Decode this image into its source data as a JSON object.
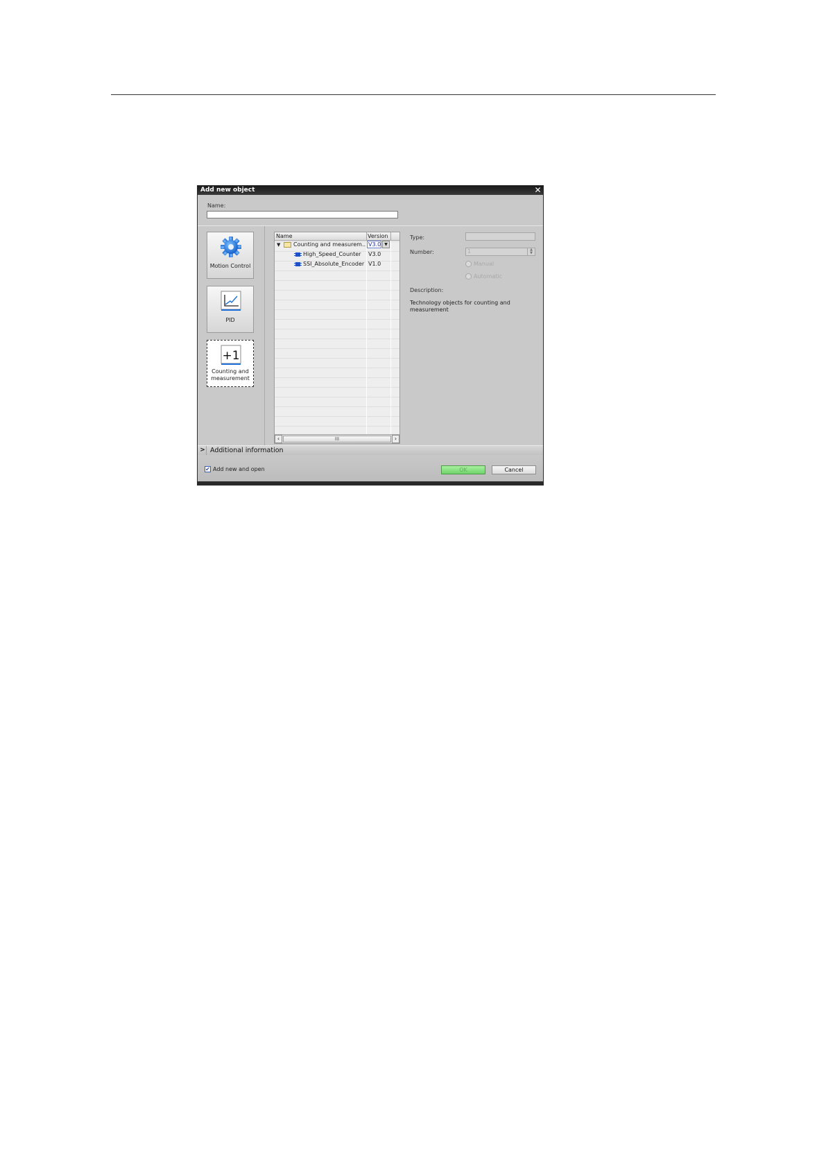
{
  "dialog": {
    "title": "Add new object",
    "name_label": "Name:",
    "name_value": ""
  },
  "categories": [
    {
      "label": "Motion Control",
      "icon": "gear-icon",
      "selected": false
    },
    {
      "label": "PID",
      "icon": "pid-chart-icon",
      "selected": false
    },
    {
      "label": "Counting and measurement",
      "label_line1": "Counting and",
      "label_line2": "measurement",
      "icon_text": "+1",
      "icon": "plus-one-icon",
      "selected": true
    }
  ],
  "tree": {
    "columns": {
      "name": "Name",
      "version": "Version"
    },
    "rows": [
      {
        "name": "Counting and measurem...",
        "version": "V3.0",
        "type": "folder",
        "expanded": true
      },
      {
        "name": "High_Speed_Counter",
        "version": "V3.0",
        "type": "object"
      },
      {
        "name": "SSI_Absolute_Encoder",
        "version": "V1.0",
        "type": "object"
      }
    ],
    "scroll_thumb": "III"
  },
  "properties": {
    "type_label": "Type:",
    "type_value": "",
    "number_label": "Number:",
    "number_value": "1",
    "radio_manual": "Manual",
    "radio_automatic": "Automatic",
    "description_label": "Description:",
    "description_text": "Technology objects for counting and measurement"
  },
  "additional_info": {
    "label": "Additional  information"
  },
  "footer": {
    "checkbox_label": "Add new and open",
    "checkbox_checked": true,
    "ok_label": "OK",
    "cancel_label": "Cancel"
  },
  "colors": {
    "accent_blue": "#1e6fd8",
    "ok_green": "#7cdc74",
    "dialog_gray": "#c9c9c9"
  }
}
